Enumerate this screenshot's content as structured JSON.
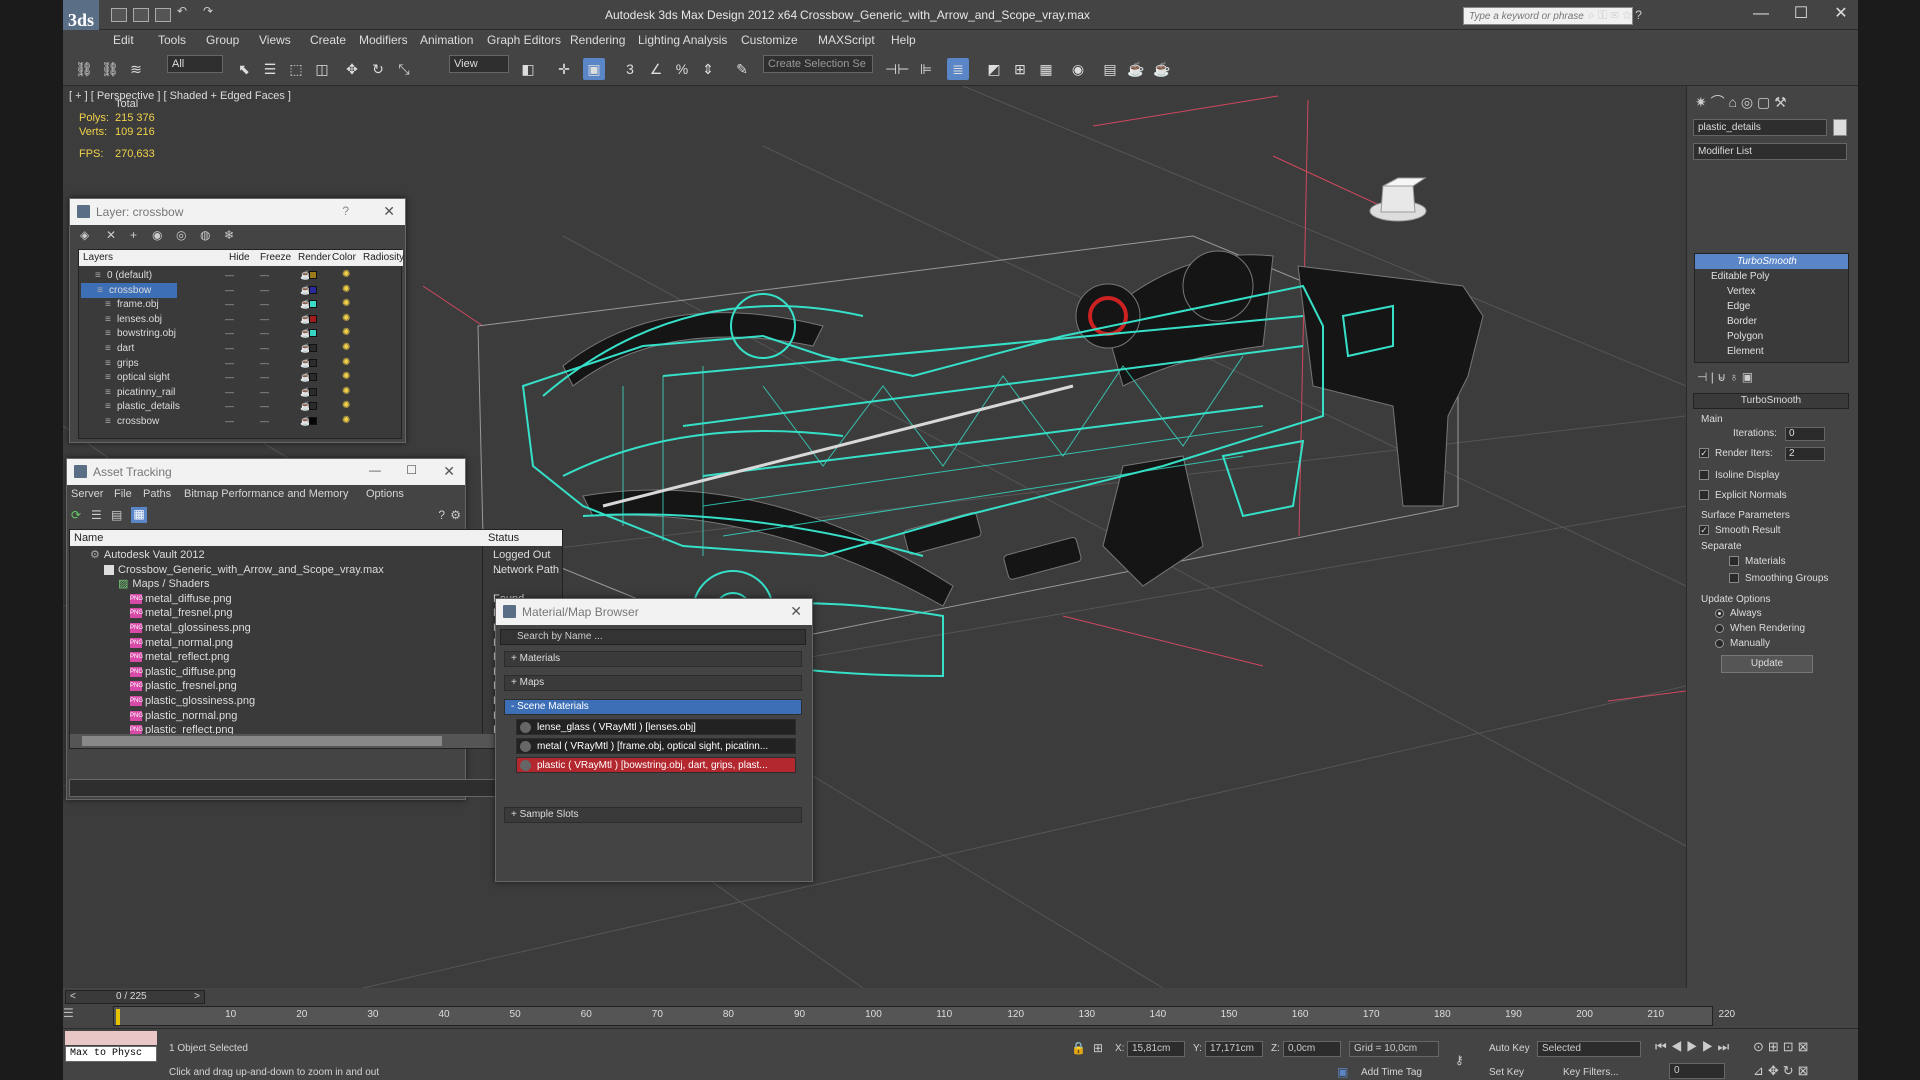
{
  "app": {
    "title": "Autodesk 3ds Max Design 2012 x64",
    "file": "Crossbow_Generic_with_Arrow_and_Scope_vray.max",
    "search_placeholder": "Type a keyword or phrase",
    "logo_text": "3ds"
  },
  "menu": [
    "Edit",
    "Tools",
    "Group",
    "Views",
    "Create",
    "Modifiers",
    "Animation",
    "Graph Editors",
    "Rendering",
    "Lighting Analysis",
    "Customize",
    "MAXScript",
    "Help"
  ],
  "toolbar": {
    "selection_filter": "All",
    "ref_coord": "View",
    "named_selection": "Create Selection Se"
  },
  "viewport": {
    "label": "[ + ] [ Perspective ] [ Shaded + Edged Faces ]",
    "total_label": "Total",
    "polys_label": "Polys:",
    "polys_value": "215 376",
    "verts_label": "Verts:",
    "verts_value": "109 216",
    "fps_label": "FPS:",
    "fps_value": "270,633"
  },
  "layer_window": {
    "title": "Layer: crossbow",
    "help": "?",
    "columns": [
      "Layers",
      "Hide",
      "Freeze",
      "Render",
      "Color",
      "Radiosity"
    ],
    "rows": [
      {
        "name": "0 (default)",
        "color": "#9a7a1a"
      },
      {
        "name": "crossbow",
        "color": "#2a2aa0"
      },
      {
        "name": "frame.obj",
        "color": "#3ad9c8"
      },
      {
        "name": "lenses.obj",
        "color": "#a01c1c"
      },
      {
        "name": "bowstring.obj",
        "color": "#36d5c2"
      },
      {
        "name": "dart",
        "color": "#2b2b2b"
      },
      {
        "name": "grips",
        "color": "#2b2b2b"
      },
      {
        "name": "optical sight",
        "color": "#2b2b2b"
      },
      {
        "name": "picatinny_rail",
        "color": "#2b2b2b"
      },
      {
        "name": "plastic_details",
        "color": "#2b2b2b"
      },
      {
        "name": "crossbow",
        "color": "#050505"
      }
    ]
  },
  "asset_window": {
    "title": "Asset Tracking",
    "menu": [
      "Server",
      "File",
      "Paths",
      "Bitmap Performance and Memory",
      "Options"
    ],
    "col_name": "Name",
    "col_status": "Status",
    "rows": [
      {
        "name": "Autodesk Vault 2012",
        "status": "Logged Out ..."
      },
      {
        "name": "Crossbow_Generic_with_Arrow_and_Scope_vray.max",
        "status": "Network Path"
      },
      {
        "name": "Maps / Shaders",
        "status": ""
      },
      {
        "name": "metal_diffuse.png",
        "status": "Found"
      },
      {
        "name": "metal_fresnel.png",
        "status": "Found"
      },
      {
        "name": "metal_glossiness.png",
        "status": "Found"
      },
      {
        "name": "metal_normal.png",
        "status": "Found"
      },
      {
        "name": "metal_reflect.png",
        "status": "Found"
      },
      {
        "name": "plastic_diffuse.png",
        "status": "Found"
      },
      {
        "name": "plastic_fresnel.png",
        "status": "Found"
      },
      {
        "name": "plastic_glossiness.png",
        "status": "Found"
      },
      {
        "name": "plastic_normal.png",
        "status": "Found"
      },
      {
        "name": "plastic_reflect.png",
        "status": "Found"
      }
    ]
  },
  "material_browser": {
    "title": "Material/Map Browser",
    "search_placeholder": "Search by Name ...",
    "groups": [
      "+ Materials",
      "+ Maps",
      "- Scene Materials",
      "+ Sample Slots"
    ],
    "materials": [
      "lense_glass  ( VRayMtl ) [lenses.obj]",
      "metal  ( VRayMtl ) [frame.obj, optical sight, picatinn...",
      "plastic  ( VRayMtl ) [bowstring.obj, dart, grips, plast..."
    ]
  },
  "command_panel": {
    "object_name": "plastic_details",
    "modifier_list": "Modifier List",
    "stack": [
      "TurboSmooth",
      "Editable Poly",
      "Vertex",
      "Edge",
      "Border",
      "Polygon",
      "Element"
    ],
    "rollout": "TurboSmooth",
    "main": "Main",
    "iterations_label": "Iterations:",
    "iterations_value": "0",
    "render_iters_label": "Render Iters:",
    "render_iters_value": "2",
    "isoline": "Isoline Display",
    "explicit_normals": "Explicit Normals",
    "surface_params": "Surface Parameters",
    "smooth_result": "Smooth Result",
    "separate": "Separate",
    "materials": "Materials",
    "smoothing_groups": "Smoothing Groups",
    "update_options": "Update Options",
    "always": "Always",
    "when_rendering": "When Rendering",
    "manually": "Manually",
    "update_btn": "Update"
  },
  "timeline": {
    "frame": "0 / 225",
    "ticks": [
      "10",
      "20",
      "30",
      "40",
      "50",
      "60",
      "70",
      "80",
      "90",
      "100",
      "110",
      "120",
      "130",
      "140",
      "150",
      "160",
      "170",
      "180",
      "190",
      "200",
      "210",
      "220"
    ]
  },
  "status": {
    "script_listener": "Max to Physc",
    "selected": "1 Object Selected",
    "prompt": "Click and drag up-and-down to zoom in and out",
    "x_label": "X:",
    "x_value": "15,81cm",
    "y_label": "Y:",
    "y_value": "17,171cm",
    "z_label": "Z:",
    "z_value": "0,0cm",
    "grid": "Grid = 10,0cm",
    "add_time_tag": "Add Time Tag",
    "auto_key": "Auto Key",
    "set_key": "Set Key",
    "key_mode": "Selected",
    "key_filters": "Key Filters...",
    "current_frame": "0"
  },
  "colors": {
    "accent": "#3d6fb6",
    "wire": "#36e0c8",
    "grid_red": "#d0485e"
  }
}
